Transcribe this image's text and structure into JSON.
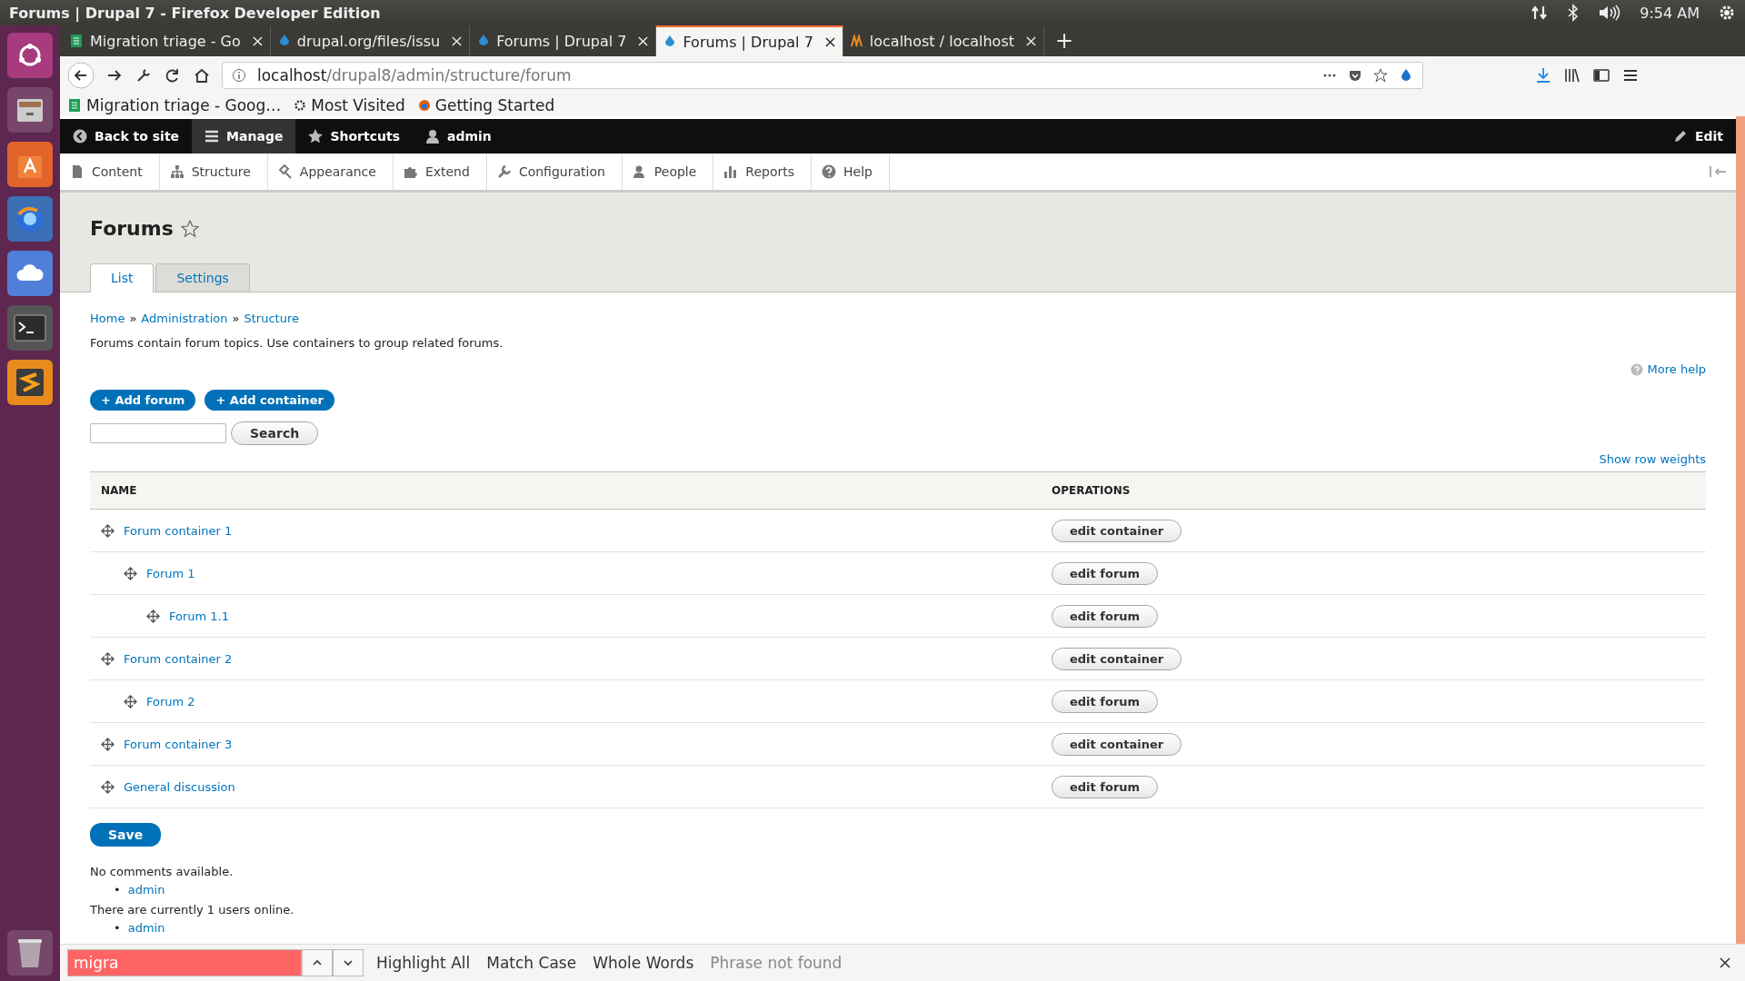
{
  "os_bar": {
    "title": "Forums | Drupal 7 - Firefox Developer Edition",
    "time": "9:54 AM"
  },
  "browser_tabs": [
    {
      "label": "Migration triage - Go",
      "selected": false,
      "kind": "sheet"
    },
    {
      "label": "drupal.org/files/issu",
      "selected": false,
      "kind": "drupal"
    },
    {
      "label": "Forums | Drupal 7",
      "selected": false,
      "kind": "drupal"
    },
    {
      "label": "Forums | Drupal 7",
      "selected": true,
      "kind": "drupal"
    },
    {
      "label": "localhost / localhost",
      "selected": false,
      "kind": "pma"
    }
  ],
  "new_tab": "+",
  "url": {
    "host": "localhost",
    "path": "/drupal8/admin/structure/forum"
  },
  "bookmarks": [
    {
      "label": "Migration triage - Goog…",
      "kind": "sheet"
    },
    {
      "label": "Most Visited",
      "kind": "gear"
    },
    {
      "label": "Getting Started",
      "kind": "firefox"
    }
  ],
  "toolbar": {
    "items": [
      {
        "label": "Back to site",
        "kind": "back",
        "selected": false
      },
      {
        "label": "Manage",
        "kind": "menu",
        "selected": true
      },
      {
        "label": "Shortcuts",
        "kind": "star",
        "selected": false
      },
      {
        "label": "admin",
        "kind": "user",
        "selected": false
      }
    ],
    "edit": "Edit"
  },
  "tray": [
    {
      "label": "Content",
      "kind": "doc"
    },
    {
      "label": "Structure",
      "kind": "tree"
    },
    {
      "label": "Appearance",
      "kind": "brush"
    },
    {
      "label": "Extend",
      "kind": "puzzle"
    },
    {
      "label": "Configuration",
      "kind": "wrench"
    },
    {
      "label": "People",
      "kind": "people"
    },
    {
      "label": "Reports",
      "kind": "bars"
    },
    {
      "label": "Help",
      "kind": "help"
    }
  ],
  "page": {
    "title": "Forums",
    "tabs": [
      {
        "label": "List",
        "selected": true
      },
      {
        "label": "Settings",
        "selected": false
      }
    ],
    "breadcrumb": [
      {
        "label": "Home"
      },
      {
        "label": "Administration"
      },
      {
        "label": "Structure"
      }
    ],
    "breadcrumb_separator": "»",
    "description": "Forums contain forum topics. Use containers to group related forums.",
    "more_help": "More help",
    "actions": [
      "+ Add forum",
      "+ Add container"
    ],
    "search_button": "Search",
    "show_row_weights": "Show row weights",
    "table": {
      "columns": [
        "NAME",
        "OPERATIONS"
      ],
      "rows": [
        {
          "name": "Forum container 1",
          "operation": "edit container",
          "children": [
            {
              "name": "Forum 1",
              "operation": "edit forum",
              "children": [
                {
                  "name": "Forum 1.1",
                  "operation": "edit forum"
                }
              ]
            }
          ]
        },
        {
          "name": "Forum container 2",
          "operation": "edit container",
          "children": [
            {
              "name": "Forum 2",
              "operation": "edit forum"
            }
          ]
        },
        {
          "name": "Forum container 3",
          "operation": "edit container"
        },
        {
          "name": "General discussion",
          "operation": "edit forum"
        }
      ]
    },
    "save": "Save",
    "comments_note": "No comments available.",
    "list_marker": "•",
    "comments_users": [
      "admin"
    ],
    "online_note": "There are currently 1 users online.",
    "online_users": [
      "admin"
    ]
  },
  "find_bar": {
    "value": "migra",
    "not_found": true,
    "options": [
      "Highlight All",
      "Match Case",
      "Whole Words"
    ],
    "status": "Phrase not found"
  }
}
